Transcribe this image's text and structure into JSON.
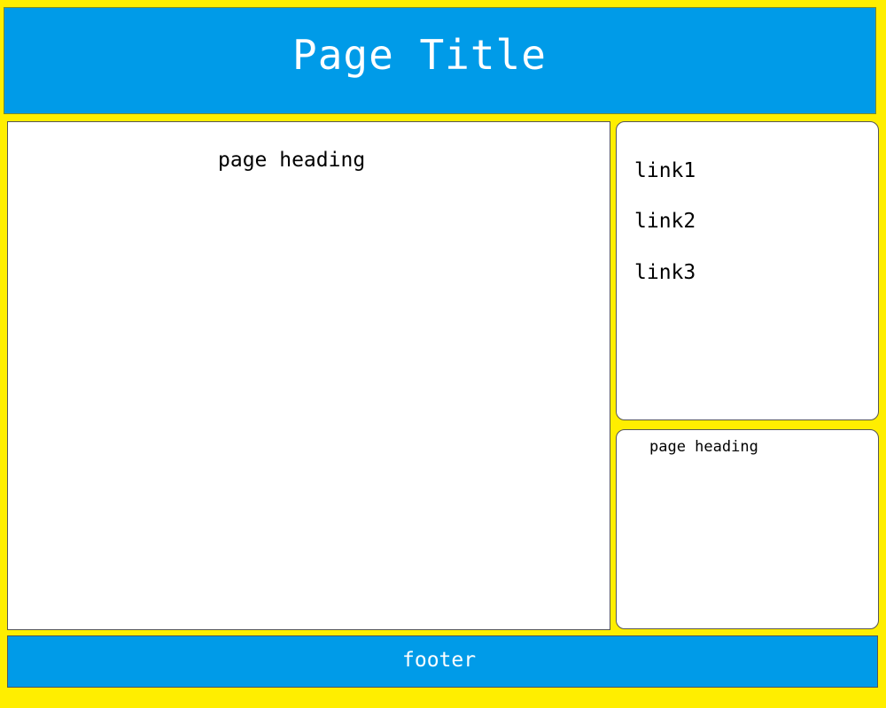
{
  "header": {
    "title": "Page Title"
  },
  "main": {
    "heading": "page heading"
  },
  "sidebar": {
    "links": [
      "link1",
      "link2",
      "link3"
    ]
  },
  "secondary_panel": {
    "heading": "page heading"
  },
  "footer": {
    "text": "footer"
  },
  "colors": {
    "page_background": "#ffee00",
    "header_background": "#009be8",
    "footer_background": "#009be8",
    "panel_background": "#ffffff",
    "title_text": "#ffffff",
    "body_text": "#000000"
  }
}
